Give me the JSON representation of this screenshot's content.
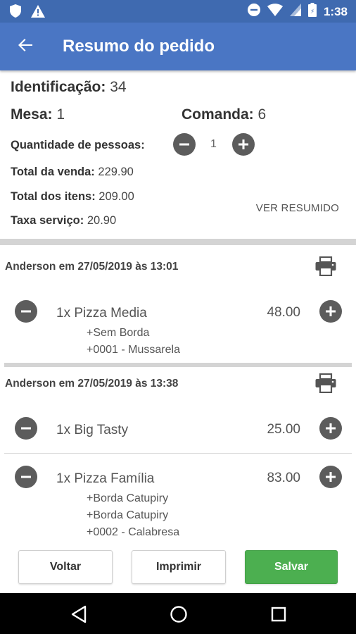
{
  "status_bar": {
    "time": "1:38"
  },
  "app_bar": {
    "title": "Resumo do pedido"
  },
  "summary": {
    "identificacao_label": "Identificação:",
    "identificacao_value": "34",
    "mesa_label": "Mesa:",
    "mesa_value": "1",
    "comanda_label": "Comanda:",
    "comanda_value": "6",
    "pessoas_label": "Quantidade de pessoas:",
    "pessoas_value": "1",
    "total_venda_label": "Total da venda:",
    "total_venda_value": "229.90",
    "total_itens_label": "Total dos itens:",
    "total_itens_value": "209.00",
    "taxa_label": "Taxa serviço:",
    "taxa_value": "20.90",
    "ver_resumido": "VER RESUMIDO"
  },
  "orders": [
    {
      "header": "Anderson em 27/05/2019 às 13:01",
      "items": [
        {
          "name": "1x Pizza Media",
          "price": "48.00",
          "addons": [
            "+Sem Borda",
            "+0001 - Mussarela"
          ]
        }
      ]
    },
    {
      "header": "Anderson em 27/05/2019 às 13:38",
      "items": [
        {
          "name": "1x Big Tasty",
          "price": "25.00",
          "addons": []
        },
        {
          "name": "1x Pizza Família",
          "price": "83.00",
          "addons": [
            "+Borda Catupiry",
            "+Borda Catupiry",
            "+0002 - Calabresa"
          ]
        }
      ]
    }
  ],
  "buttons": {
    "voltar": "Voltar",
    "imprimir": "Imprimir",
    "salvar": "Salvar"
  },
  "colors": {
    "app_bar": "#4a76c4",
    "status_bar": "#3f6ab0",
    "save": "#4caf50",
    "icon_gray": "#5c5c5c"
  },
  "icons": {
    "back": "arrow-left-icon",
    "minus": "minus-circle-icon",
    "plus": "plus-circle-icon",
    "print": "printer-icon",
    "nav_back": "nav-back-icon",
    "nav_home": "nav-home-icon",
    "nav_recents": "nav-recents-icon"
  }
}
